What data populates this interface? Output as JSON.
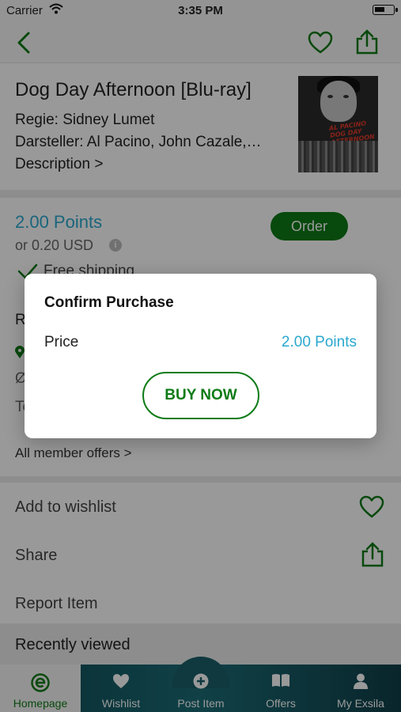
{
  "status_bar": {
    "carrier": "Carrier",
    "time": "3:35 PM"
  },
  "product": {
    "title": "Dog Day Afternoon [Blu-ray]",
    "director": "Regie: Sidney Lumet",
    "cast": "Darsteller: Al Pacino, John Cazale,…",
    "description_link": "Description >",
    "poster_text": "AL PACINO DOG DAY AFTERNOON"
  },
  "pricing": {
    "points": "2.00 Points",
    "usd": "or 0.20 USD",
    "info_glyph": "i",
    "order_label": "Order",
    "shipping": "Free shipping"
  },
  "obscured": {
    "r": "R",
    "o": "Ø",
    "t": "Te"
  },
  "member_offers": "All member offers >",
  "actions": {
    "wishlist": "Add to wishlist",
    "share": "Share",
    "report": "Report Item"
  },
  "recently_viewed": "Recently viewed",
  "tabs": [
    {
      "label": "Homepage",
      "icon": "homepage-icon"
    },
    {
      "label": "Wishlist",
      "icon": "heart-icon"
    },
    {
      "label": "Post Item",
      "icon": "plus-icon"
    },
    {
      "label": "Offers",
      "icon": "book-icon"
    },
    {
      "label": "My Exsila",
      "icon": "person-icon"
    }
  ],
  "modal": {
    "title": "Confirm Purchase",
    "price_label": "Price",
    "price_value": "2.00 Points",
    "buy_label": "BUY NOW"
  },
  "colors": {
    "brand_green": "#0e7b16",
    "points_blue": "#2aa8cf",
    "tabbar_teal": "#1b6d77"
  }
}
